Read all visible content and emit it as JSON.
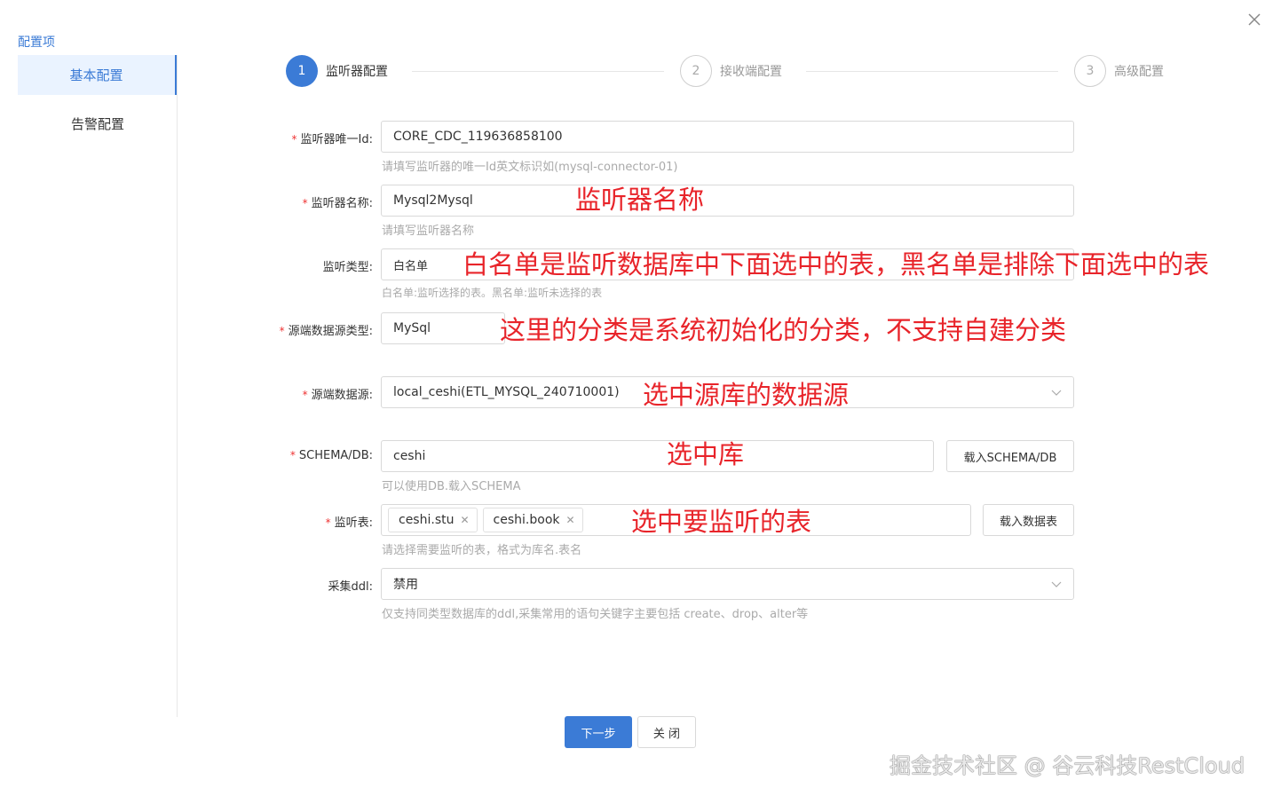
{
  "sidebar": {
    "title": "配置项",
    "items": [
      {
        "label": "基本配置",
        "active": true
      },
      {
        "label": "告警配置",
        "active": false
      }
    ]
  },
  "steps": [
    {
      "num": "1",
      "label": "监听器配置",
      "active": true
    },
    {
      "num": "2",
      "label": "接收端配置",
      "active": false
    },
    {
      "num": "3",
      "label": "高级配置",
      "active": false
    }
  ],
  "form": {
    "listener_id": {
      "label": "监听器唯一Id:",
      "value": "CORE_CDC_119636858100",
      "hint": "请填写监听器的唯一Id英文标识如(mysql-connector-01)"
    },
    "listener_name": {
      "label": "监听器名称:",
      "value": "Mysql2Mysql",
      "hint": "请填写监听器名称"
    },
    "listener_type": {
      "label": "监听类型:",
      "value": "白名单",
      "hint": "白名单:监听选择的表。黑名单:监听未选择的表"
    },
    "source_type": {
      "label": "源端数据源类型:",
      "value": "MySql"
    },
    "source": {
      "label": "源端数据源:",
      "value": "local_ceshi(ETL_MYSQL_240710001)"
    },
    "schema": {
      "label": "SCHEMA/DB:",
      "value": "ceshi",
      "button": "载入SCHEMA/DB",
      "hint": "可以使用DB.载入SCHEMA"
    },
    "tables": {
      "label": "监听表:",
      "tags": [
        "ceshi.stu",
        "ceshi.book"
      ],
      "button": "载入数据表",
      "hint": "请选择需要监听的表，格式为库名.表名"
    },
    "ddl": {
      "label": "采集ddl:",
      "value": "禁用",
      "hint": "仅支持同类型数据库的ddl,采集常用的语句关键字主要包括 create、drop、alter等"
    }
  },
  "annotations": {
    "name": "监听器名称",
    "type": "白名单是监听数据库中下面选中的表，黑名单是排除下面选中的表",
    "source_type": "这里的分类是系统初始化的分类，不支持自建分类",
    "source": "选中源库的数据源",
    "schema": "选中库",
    "tables": "选中要监听的表"
  },
  "footer": {
    "next": "下一步",
    "close": "关 闭"
  },
  "watermark": "掘金技术社区 @ 谷云科技RestCloud",
  "colors": {
    "accent": "#3b7bd6",
    "annotation": "#e8242a",
    "required": "#e33"
  }
}
